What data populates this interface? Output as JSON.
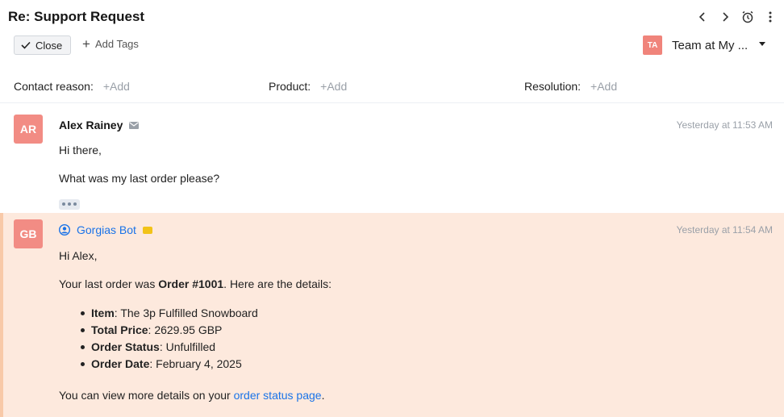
{
  "header": {
    "title": "Re: Support Request",
    "close_label": "Close",
    "add_tags_label": "Add Tags",
    "team": {
      "initials": "TA",
      "name": "Team at My ..."
    }
  },
  "fields": [
    {
      "label": "Contact reason:",
      "add": "+Add"
    },
    {
      "label": "Product:",
      "add": "+Add"
    },
    {
      "label": "Resolution:",
      "add": "+Add"
    }
  ],
  "messages": [
    {
      "initials": "AR",
      "sender": "Alex Rainey",
      "time": "Yesterday at 11:53 AM",
      "lines": [
        "Hi there,",
        "What was my last order please?"
      ]
    },
    {
      "initials": "GB",
      "sender": "Gorgias Bot",
      "time": "Yesterday at 11:54 AM",
      "greeting": "Hi Alex,",
      "intro_pre": "Your last order was ",
      "intro_order": "Order #1001",
      "intro_post": ". Here are the details:",
      "details": [
        {
          "key": "Item",
          "value": ": The 3p Fulfilled Snowboard"
        },
        {
          "key": "Total Price",
          "value": ": 2629.95 GBP"
        },
        {
          "key": "Order Status",
          "value": ": Unfulfilled"
        },
        {
          "key": "Order Date",
          "value": ": February 4, 2025"
        }
      ],
      "footer_pre": "You can view more details on your ",
      "footer_link": "order status page",
      "footer_post": "."
    }
  ],
  "icons": {
    "prev": "chevron-left-icon",
    "next": "chevron-right-icon",
    "snooze": "alarm-clock-icon",
    "more": "more-vertical-icon",
    "check": "check-icon",
    "plus": "plus-icon",
    "email": "email-icon",
    "bot": "user-circle-icon",
    "note": "internal-note-icon"
  },
  "colors": {
    "avatar": "#f28c84",
    "bot_bg": "#fde9dd",
    "link": "#1a73e8"
  }
}
